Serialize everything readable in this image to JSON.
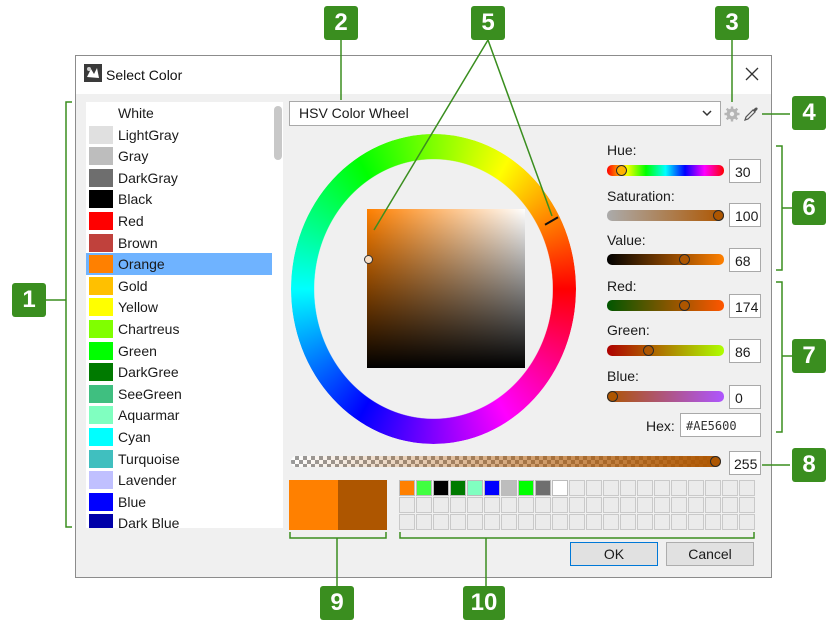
{
  "window": {
    "title": "Select Color"
  },
  "color_list": {
    "items": [
      {
        "name": "White",
        "color": "#ffffff"
      },
      {
        "name": "LightGray",
        "color": "#e0e0e0"
      },
      {
        "name": "Gray",
        "color": "#bdbdbd"
      },
      {
        "name": "DarkGray",
        "color": "#6e6e6e"
      },
      {
        "name": "Black",
        "color": "#000000"
      },
      {
        "name": "Red",
        "color": "#ff0000"
      },
      {
        "name": "Brown",
        "color": "#c0413c"
      },
      {
        "name": "Orange",
        "color": "#ff8000"
      },
      {
        "name": "Gold",
        "color": "#ffc000"
      },
      {
        "name": "Yellow",
        "color": "#ffff00"
      },
      {
        "name": "Chartreus",
        "color": "#80ff00"
      },
      {
        "name": "Green",
        "color": "#00ff00"
      },
      {
        "name": "DarkGree",
        "color": "#007a00"
      },
      {
        "name": "SeeGreen",
        "color": "#3fbf80"
      },
      {
        "name": "Aquarmar",
        "color": "#80ffc0"
      },
      {
        "name": "Cyan",
        "color": "#00ffff"
      },
      {
        "name": "Turquoise",
        "color": "#40bfbf"
      },
      {
        "name": "Lavender",
        "color": "#c0c0ff"
      },
      {
        "name": "Blue",
        "color": "#0000ff"
      },
      {
        "name": "Dark Blue",
        "color": "#0000a8"
      }
    ],
    "selected_index": 7
  },
  "mode_select": {
    "value": "HSV Color Wheel"
  },
  "sliders": {
    "hue": {
      "label": "Hue:",
      "value": "30",
      "fraction": 0.083
    },
    "saturation": {
      "label": "Saturation:",
      "value": "100",
      "fraction": 1.0
    },
    "value": {
      "label": "Value:",
      "value": "68",
      "fraction": 0.68
    },
    "red": {
      "label": "Red:",
      "value": "174",
      "fraction": 0.68
    },
    "green": {
      "label": "Green:",
      "value": "86",
      "fraction": 0.34
    },
    "blue": {
      "label": "Blue:",
      "value": "0",
      "fraction": 0.0
    }
  },
  "hex": {
    "label": "Hex:",
    "value": "#AE5600"
  },
  "alpha": {
    "value": "255",
    "fraction": 1.0
  },
  "preview": {
    "new_color": "#ff8000",
    "old_color": "#ae5600"
  },
  "custom_colors": {
    "row1": [
      "#ff8000",
      "#40ff40",
      "#000000",
      "#007a00",
      "#80ffc0",
      "#0000ff",
      "#bdbdbd",
      "#00ff00",
      "#6e6e6e",
      "#ffffff"
    ]
  },
  "buttons": {
    "ok": "OK",
    "cancel": "Cancel"
  },
  "callouts": [
    "1",
    "2",
    "3",
    "4",
    "5",
    "6",
    "7",
    "8",
    "9",
    "10"
  ],
  "colors": {
    "accent": "#3a8e1f",
    "selection": "#6fb3ff",
    "current_color": "#ae5600"
  }
}
